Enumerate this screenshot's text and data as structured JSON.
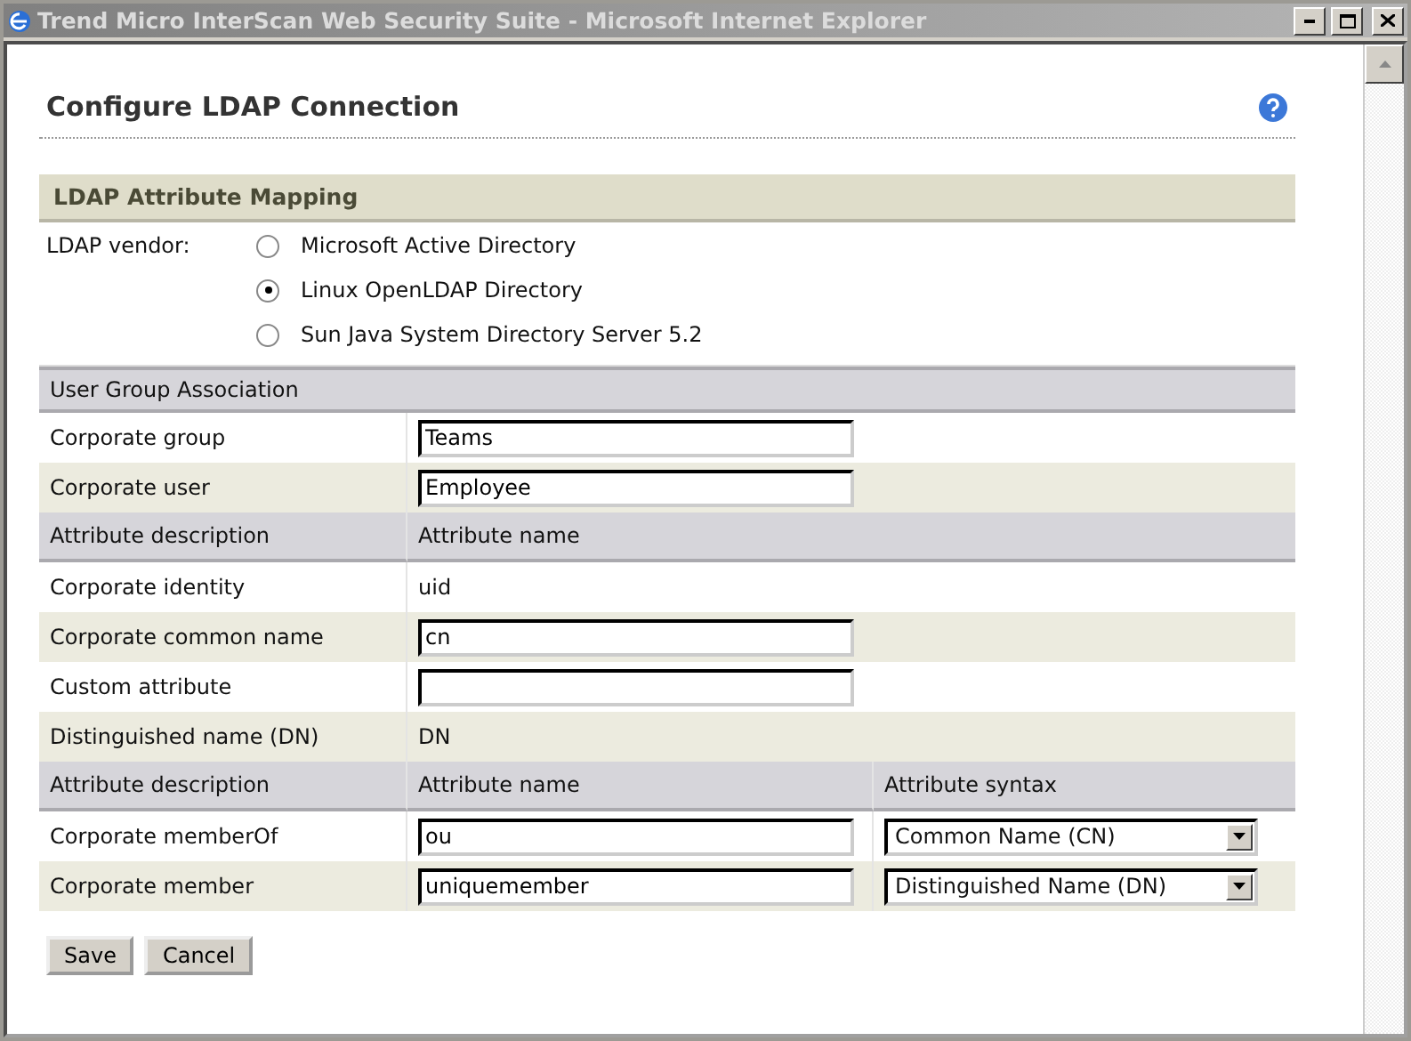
{
  "window": {
    "title": "Trend Micro InterScan Web Security Suite - Microsoft Internet Explorer"
  },
  "page_title": "Configure LDAP Connection",
  "mapping": {
    "title": "LDAP Attribute Mapping",
    "label": "LDAP vendor:",
    "vendors": [
      {
        "label": "Microsoft Active Directory",
        "selected": false
      },
      {
        "label": "Linux OpenLDAP Directory",
        "selected": true
      },
      {
        "label": "Sun Java System Directory Server 5.2",
        "selected": false
      }
    ]
  },
  "table": {
    "rows": [
      {
        "kind": "section",
        "label": "User Group Association"
      },
      {
        "kind": "input",
        "label": "Corporate group",
        "value": "Teams"
      },
      {
        "kind": "input",
        "label": "Corporate user",
        "value": "Employee"
      },
      {
        "kind": "columns",
        "cells": [
          "Attribute description",
          "Attribute name"
        ]
      },
      {
        "kind": "text",
        "label": "Corporate identity",
        "value": "uid"
      },
      {
        "kind": "input",
        "label": "Corporate common name",
        "value": "cn"
      },
      {
        "kind": "input",
        "label": "Custom attribute"
      },
      {
        "kind": "text",
        "label": "Distinguished name (DN)",
        "value": "DN"
      },
      {
        "kind": "columns",
        "cells": [
          "Attribute description",
          "Attribute name",
          "Attribute syntax"
        ]
      },
      {
        "kind": "select",
        "label": "Corporate memberOf",
        "value": "ou",
        "syntax": "Common Name (CN)"
      },
      {
        "kind": "select",
        "label": "Corporate member",
        "value": "uniquemember",
        "syntax": "Distinguished Name (DN)"
      }
    ]
  },
  "buttons": [
    "Save",
    "Cancel"
  ]
}
